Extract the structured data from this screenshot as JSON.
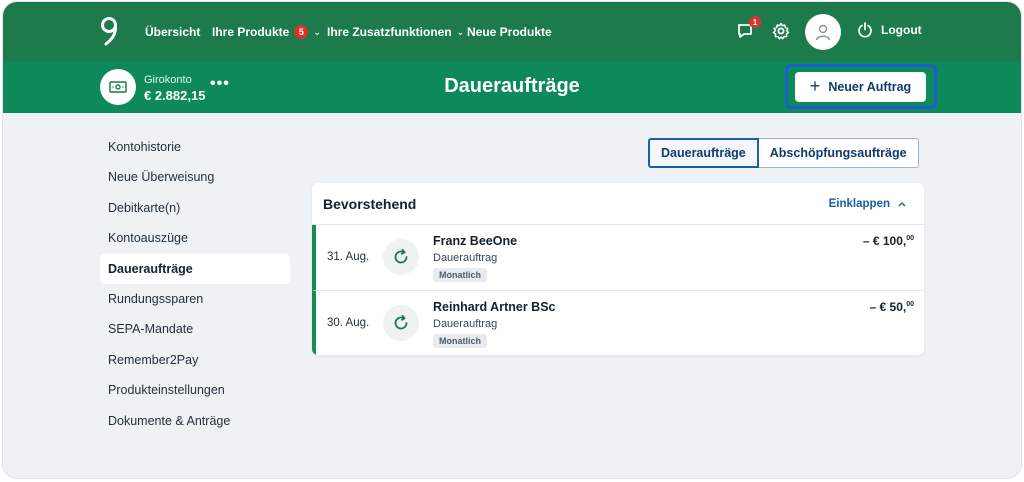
{
  "nav": {
    "items": [
      {
        "label": "Übersicht"
      },
      {
        "label": "Ihre Produkte",
        "badge": "5"
      },
      {
        "label": "Ihre Zusatzfunktionen"
      },
      {
        "label": "Neue Produkte"
      }
    ],
    "notification_count": "1",
    "logout_label": "Logout"
  },
  "account": {
    "name": "Girokonto",
    "balance": "€ 2.882,15",
    "more": "•••"
  },
  "page": {
    "title": "Daueraufträge",
    "new_order_label": "Neuer Auftrag"
  },
  "sidebar": {
    "items": [
      {
        "label": "Kontohistorie"
      },
      {
        "label": "Neue Überweisung"
      },
      {
        "label": "Debitkarte(n)"
      },
      {
        "label": "Kontoauszüge"
      },
      {
        "label": "Daueraufträge",
        "active": true
      },
      {
        "label": "Rundungssparen"
      },
      {
        "label": "SEPA-Mandate"
      },
      {
        "label": "Remember2Pay"
      },
      {
        "label": "Produkteinstellungen"
      },
      {
        "label": "Dokumente & Anträge"
      }
    ]
  },
  "tabs": [
    {
      "label": "Daueraufträge",
      "active": true
    },
    {
      "label": "Abschöpfungsaufträge"
    }
  ],
  "upcoming": {
    "title": "Bevorstehend",
    "collapse_label": "Einklappen",
    "rows": [
      {
        "date": "31. Aug.",
        "name": "Franz BeeOne",
        "type": "Dauerauftrag",
        "frequency": "Monatlich",
        "amount_main": "– € 100,",
        "amount_cents": "00"
      },
      {
        "date": "30. Aug.",
        "name": "Reinhard Artner BSc",
        "type": "Dauerauftrag",
        "frequency": "Monatlich",
        "amount_main": "– € 50,",
        "amount_cents": "00"
      }
    ]
  },
  "colors": {
    "topnav": "#1c7a4b",
    "subheader": "#0e8a5a",
    "accent": "#1a5fa8",
    "badge": "#d9342b"
  }
}
